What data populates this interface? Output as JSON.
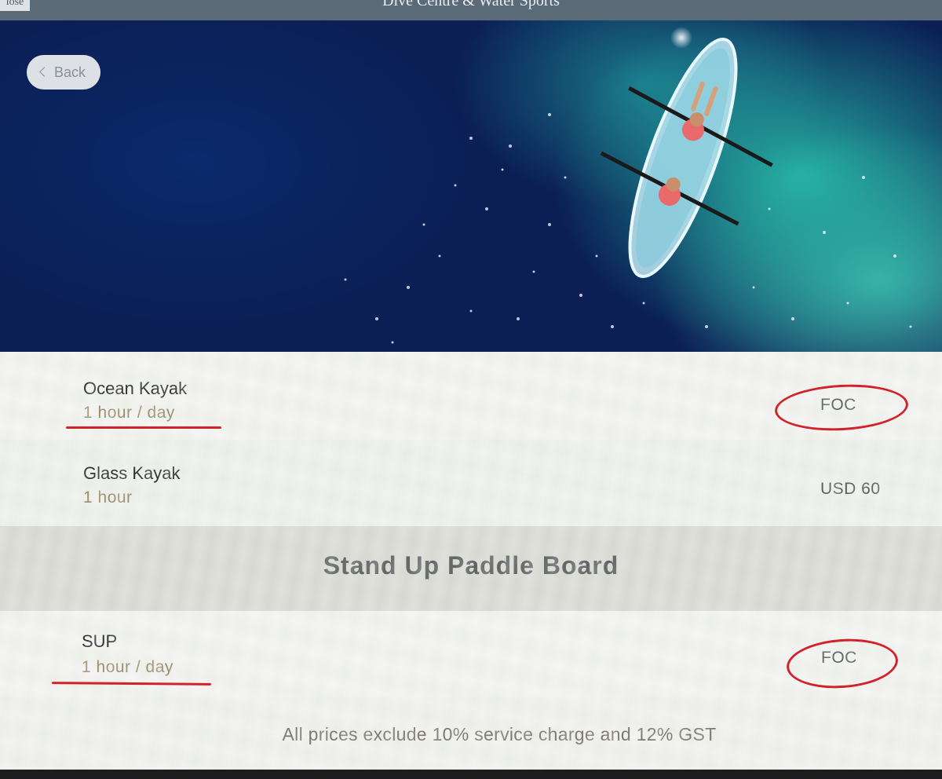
{
  "header": {
    "close_label": "lose",
    "title": "Dive Centre & Water Sports"
  },
  "hero": {
    "back_label": "Back"
  },
  "items": [
    {
      "name": "Ocean Kayak",
      "duration": "1 hour / day",
      "price": "FOC"
    },
    {
      "name": "Glass Kayak",
      "duration": "1 hour",
      "price": "USD 60"
    }
  ],
  "section": {
    "title": "Stand Up Paddle Board"
  },
  "sup_items": [
    {
      "name": "SUP",
      "duration": "1 hour / day",
      "price": "FOC"
    }
  ],
  "footer": {
    "note": "All prices exclude 10% service charge and 12% GST"
  },
  "colors": {
    "annotation": "#d2232a",
    "duration_text": "#9a8a6a",
    "section_band": "#d9dad4"
  }
}
